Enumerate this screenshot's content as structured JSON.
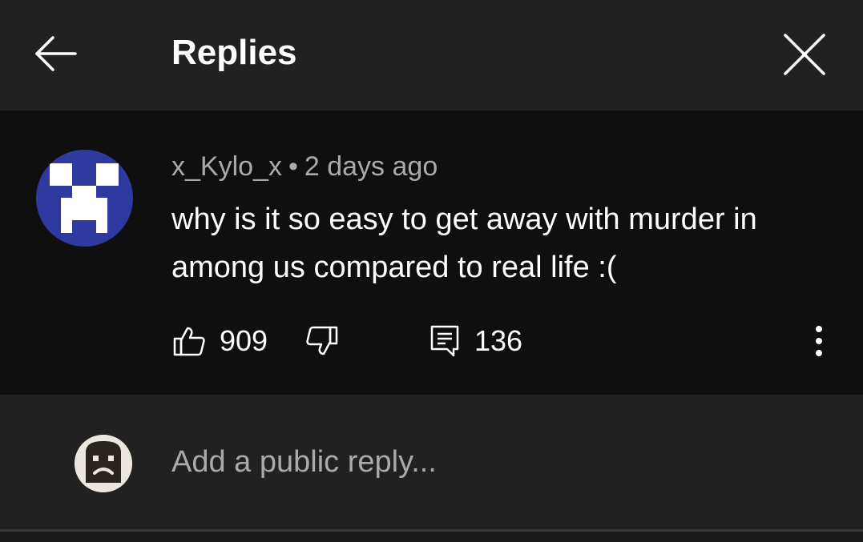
{
  "header": {
    "title": "Replies",
    "back_icon": "arrow-left-icon",
    "close_icon": "close-icon"
  },
  "comment": {
    "author": "x_Kylo_x",
    "separator": "•",
    "timestamp": "2 days ago",
    "text": "why is it so easy to get away with murder in among us compared to real life :(",
    "avatar_icon": "creeper-face-avatar",
    "avatar_color": "#2f3aa0",
    "likes": "909",
    "replies": "136",
    "like_icon": "thumb-up-icon",
    "dislike_icon": "thumb-down-icon",
    "reply_icon": "comment-icon",
    "more_icon": "more-vertical-icon"
  },
  "reply_box": {
    "placeholder": "Add a public reply...",
    "avatar_icon": "sad-toast-avatar"
  },
  "colors": {
    "header_bg": "#212121",
    "comment_bg": "#0f0f0f",
    "secondary_text": "#aaaaaa"
  }
}
